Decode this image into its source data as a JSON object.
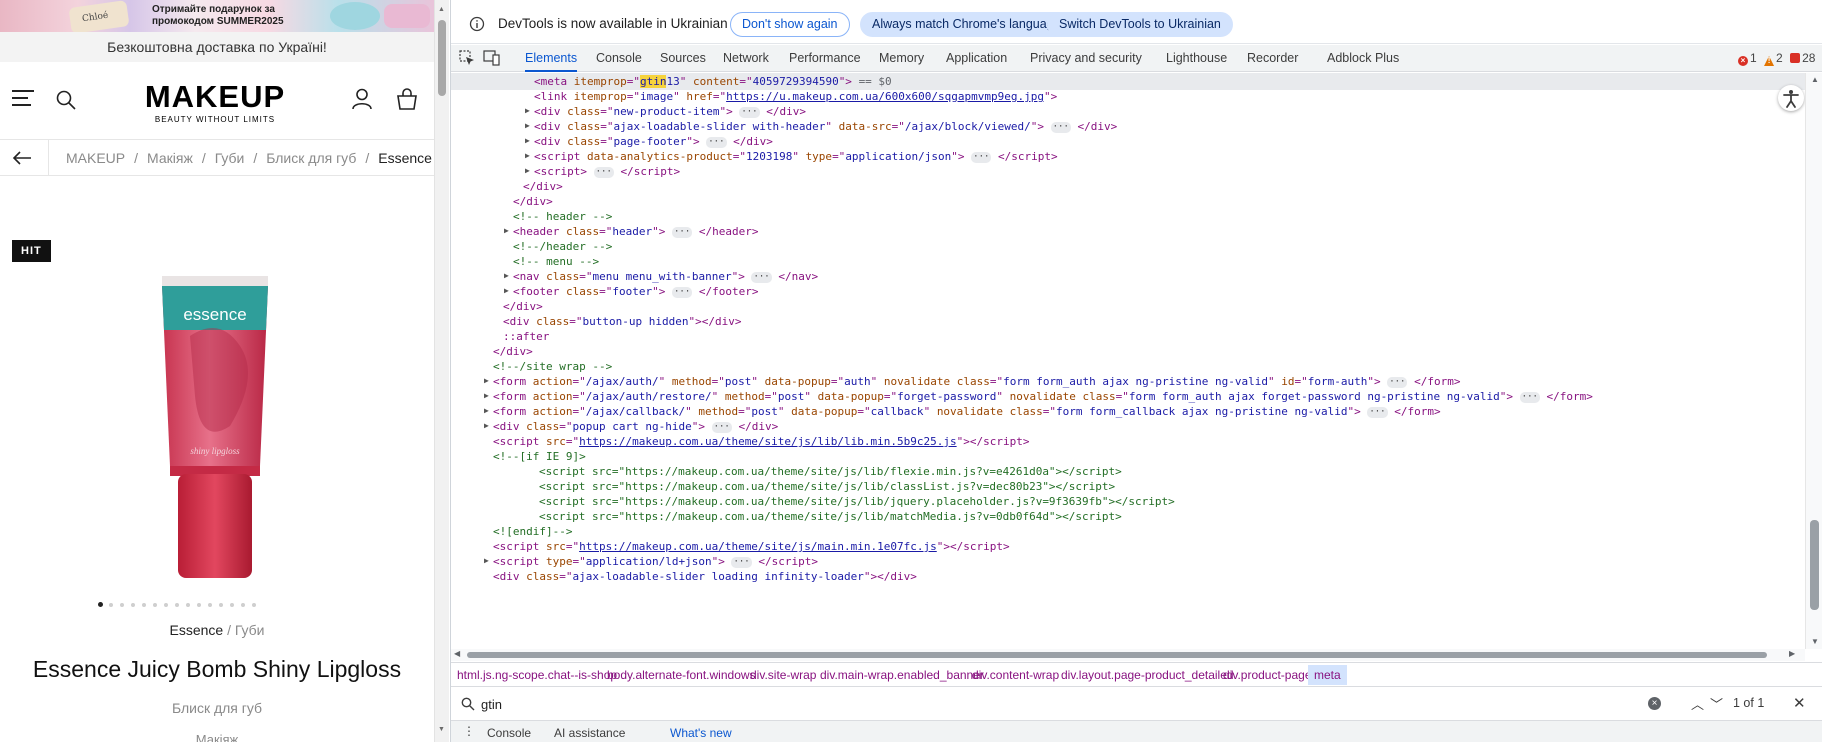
{
  "site": {
    "promo": "Отримайте подарунок за промокодом SUMMER2025",
    "promo_brand": "Chloé",
    "free_shipping": "Безкоштовна доставка по Україні!",
    "logo": "MAKEUP",
    "tagline": "BEAUTY WITHOUT LIMITS",
    "breadcrumbs": [
      "MAKEUP",
      "Макіяж",
      "Губи",
      "Блиск для губ",
      "Essence"
    ],
    "badge": "HIT",
    "tube_brand": "essence",
    "tube_label": "shiny lipgloss",
    "carousel": {
      "count": 15,
      "active": 0
    },
    "brand": "Essence",
    "brand_sep": " / ",
    "category": "Губи",
    "title": "Essence Juicy Bomb Shiny Lipgloss",
    "subtitle": "Блиск для губ",
    "more": "Макіяж"
  },
  "devtools": {
    "info_message": "DevTools is now available in Ukrainian",
    "buttons": {
      "dont_show": "Don't show again",
      "match": "Always match Chrome's language",
      "switch": "Switch DevTools to Ukrainian"
    },
    "tabs": [
      "Elements",
      "Console",
      "Sources",
      "Network",
      "Performance",
      "Memory",
      "Application",
      "Privacy and security",
      "Lighthouse",
      "Recorder",
      "Adblock Plus"
    ],
    "active_tab": "Elements",
    "counts": {
      "errors": "1",
      "warnings": "2",
      "issues": "28"
    },
    "breadcrumbs": [
      "html.js.ng-scope.chat--is-shop",
      "body.alternate-font.windows",
      "div.site-wrap",
      "div.main-wrap.enabled_banner",
      "div.content-wrap",
      "div.layout.page-product_detailed",
      "div.product-page",
      "meta"
    ],
    "search": {
      "value": "gtin",
      "results": "1 of 1"
    },
    "drawer": {
      "menu": "⋮",
      "tabs": [
        "Console",
        "AI assistance",
        "What's new"
      ]
    },
    "selected_marker": "== $0",
    "colors": {
      "accent": "#0b57d0",
      "tag": "#881280",
      "attr_name": "#994500",
      "attr_value": "#1a1aa6",
      "comment": "#236e25",
      "highlight": "#f6d33c"
    }
  }
}
